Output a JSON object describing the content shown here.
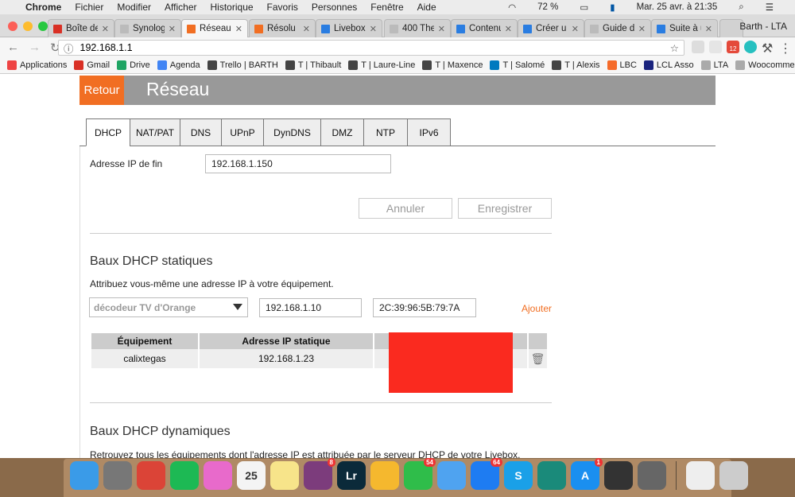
{
  "menubar": {
    "app": "Chrome",
    "items": [
      "Fichier",
      "Modifier",
      "Afficher",
      "Historique",
      "Favoris",
      "Personnes",
      "Fenêtre",
      "Aide"
    ],
    "battery": "72 %",
    "datetime": "Mar. 25 avr. à  21:35"
  },
  "browser": {
    "profile": "Barth - LTA",
    "url": "192.168.1.1",
    "tabs": [
      {
        "title": "Boîte de r",
        "color": "#d93025"
      },
      {
        "title": "Synology",
        "color": "#bbb"
      },
      {
        "title": "Réseau -",
        "color": "#f16e22"
      },
      {
        "title": "Résolu : A",
        "color": "#f16e22"
      },
      {
        "title": "Livebox b",
        "color": "#2a7de1"
      },
      {
        "title": "400 The",
        "color": "#bbb"
      },
      {
        "title": "Contenu",
        "color": "#2a7de1"
      },
      {
        "title": "Créer u",
        "color": "#2a7de1"
      },
      {
        "title": "Guide de",
        "color": "#bbb"
      },
      {
        "title": "Suite à un",
        "color": "#2a7de1"
      }
    ],
    "gmail_badge": "12",
    "bookmarks": [
      {
        "label": "Applications",
        "color": "#e44"
      },
      {
        "label": "Gmail",
        "color": "#d93025"
      },
      {
        "label": "Drive",
        "color": "#1fa463"
      },
      {
        "label": "Agenda",
        "color": "#4285f4"
      },
      {
        "label": "Trello | BARTH",
        "color": "#444"
      },
      {
        "label": "T | Thibault",
        "color": "#444"
      },
      {
        "label": "T | Laure-Line",
        "color": "#444"
      },
      {
        "label": "T | Maxence",
        "color": "#444"
      },
      {
        "label": "T | Salomé",
        "color": "#0079bf"
      },
      {
        "label": "T | Alexis",
        "color": "#444"
      },
      {
        "label": "LBC",
        "color": "#f56b2a"
      },
      {
        "label": "LCL Asso",
        "color": "#1a237e"
      },
      {
        "label": "LTA",
        "color": "#aaa"
      },
      {
        "label": "Woocommerce",
        "color": "#aaa"
      }
    ]
  },
  "page": {
    "back": "Retour",
    "title": "Réseau",
    "tabs": [
      "DHCP",
      "NAT/PAT",
      "DNS",
      "UPnP",
      "DynDNS",
      "DMZ",
      "NTP",
      "IPv6"
    ],
    "end_ip_label": "Adresse IP de fin",
    "end_ip_value": "192.168.1.150",
    "cancel": "Annuler",
    "save": "Enregistrer",
    "static": {
      "title": "Baux DHCP statiques",
      "desc": "Attribuez vous-même une adresse IP à votre équipement.",
      "device_select": "décodeur TV d'Orange",
      "ip_value": "192.168.1.10",
      "mac_value": "2C:39:96:5B:79:7A",
      "add": "Ajouter",
      "columns": [
        "Équipement",
        "Adresse IP statique",
        ""
      ],
      "rows": [
        {
          "device": "calixtegas",
          "ip": "192.168.1.23"
        }
      ]
    },
    "dynamic": {
      "title": "Baux DHCP dynamiques",
      "desc": "Retrouvez tous les équipements dont l'adresse IP est attribuée par le serveur DHCP de votre Livebox."
    },
    "redaction_color": "#fa2a1f",
    "accent": "#f16e22"
  },
  "dock": [
    {
      "name": "finder",
      "color": "#3a9be8"
    },
    {
      "name": "launchpad",
      "color": "#777"
    },
    {
      "name": "chrome",
      "color": "#db4437"
    },
    {
      "name": "spotify",
      "color": "#1db954"
    },
    {
      "name": "itunes",
      "color": "#e86acb"
    },
    {
      "name": "calendar",
      "color": "#f4f4f4",
      "text": "25"
    },
    {
      "name": "notes",
      "color": "#f7e48a"
    },
    {
      "name": "slack",
      "color": "#7c3c7c",
      "badge": "8"
    },
    {
      "name": "lightroom",
      "color": "#0b2a3a",
      "text": "Lr"
    },
    {
      "name": "airtable",
      "color": "#f5b82e"
    },
    {
      "name": "whatsapp",
      "color": "#2fbd4a",
      "badge": "54"
    },
    {
      "name": "messages",
      "color": "#4fa3f0"
    },
    {
      "name": "messenger",
      "color": "#1e7cf2",
      "badge": "64"
    },
    {
      "name": "skype",
      "color": "#1aa0e8",
      "text": "S"
    },
    {
      "name": "dashlane",
      "color": "#1a8a7a"
    },
    {
      "name": "app-store",
      "color": "#1a8ff0",
      "badge": "1",
      "text": "A"
    },
    {
      "name": "printer",
      "color": "#333"
    },
    {
      "name": "system-preferences",
      "color": "#666"
    },
    {
      "name": "documents",
      "color": "#eee"
    },
    {
      "name": "trash",
      "color": "#ccc"
    }
  ]
}
